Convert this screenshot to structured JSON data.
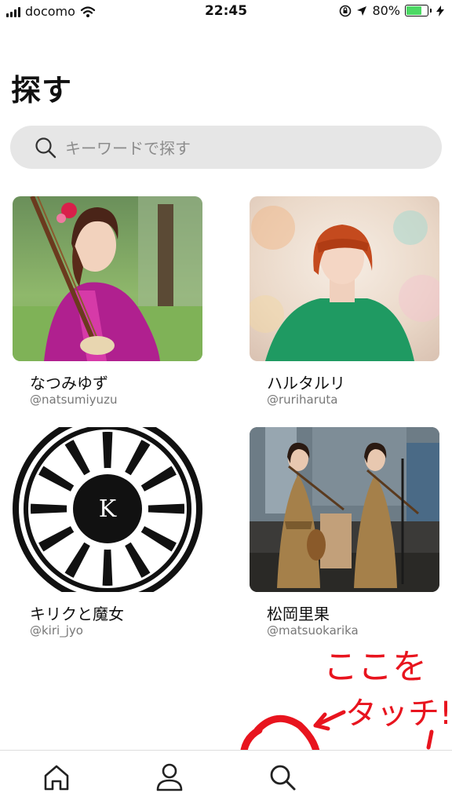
{
  "status": {
    "carrier": "docomo",
    "time": "22:45",
    "battery_pct": "80%",
    "battery_level": 0.8,
    "battery_color": "#4cd964"
  },
  "header": {
    "title": "探す"
  },
  "search": {
    "placeholder": "キーワードで探す"
  },
  "artists": [
    {
      "name": "なつみゆず",
      "handle": "@natsumiyuzu"
    },
    {
      "name": "ハルタルリ",
      "handle": "@ruriharuta"
    },
    {
      "name": "キリクと魔女",
      "handle": "@kiri_jyo",
      "logo_letter": "K"
    },
    {
      "name": "松岡里果",
      "handle": "@matsuokarika"
    }
  ],
  "annotation": {
    "text_line1": "ここを",
    "text_line2": "タッチ!",
    "color": "#e8141e"
  },
  "tabs": [
    {
      "icon": "home-icon"
    },
    {
      "icon": "profile-icon"
    },
    {
      "icon": "search-icon"
    }
  ]
}
